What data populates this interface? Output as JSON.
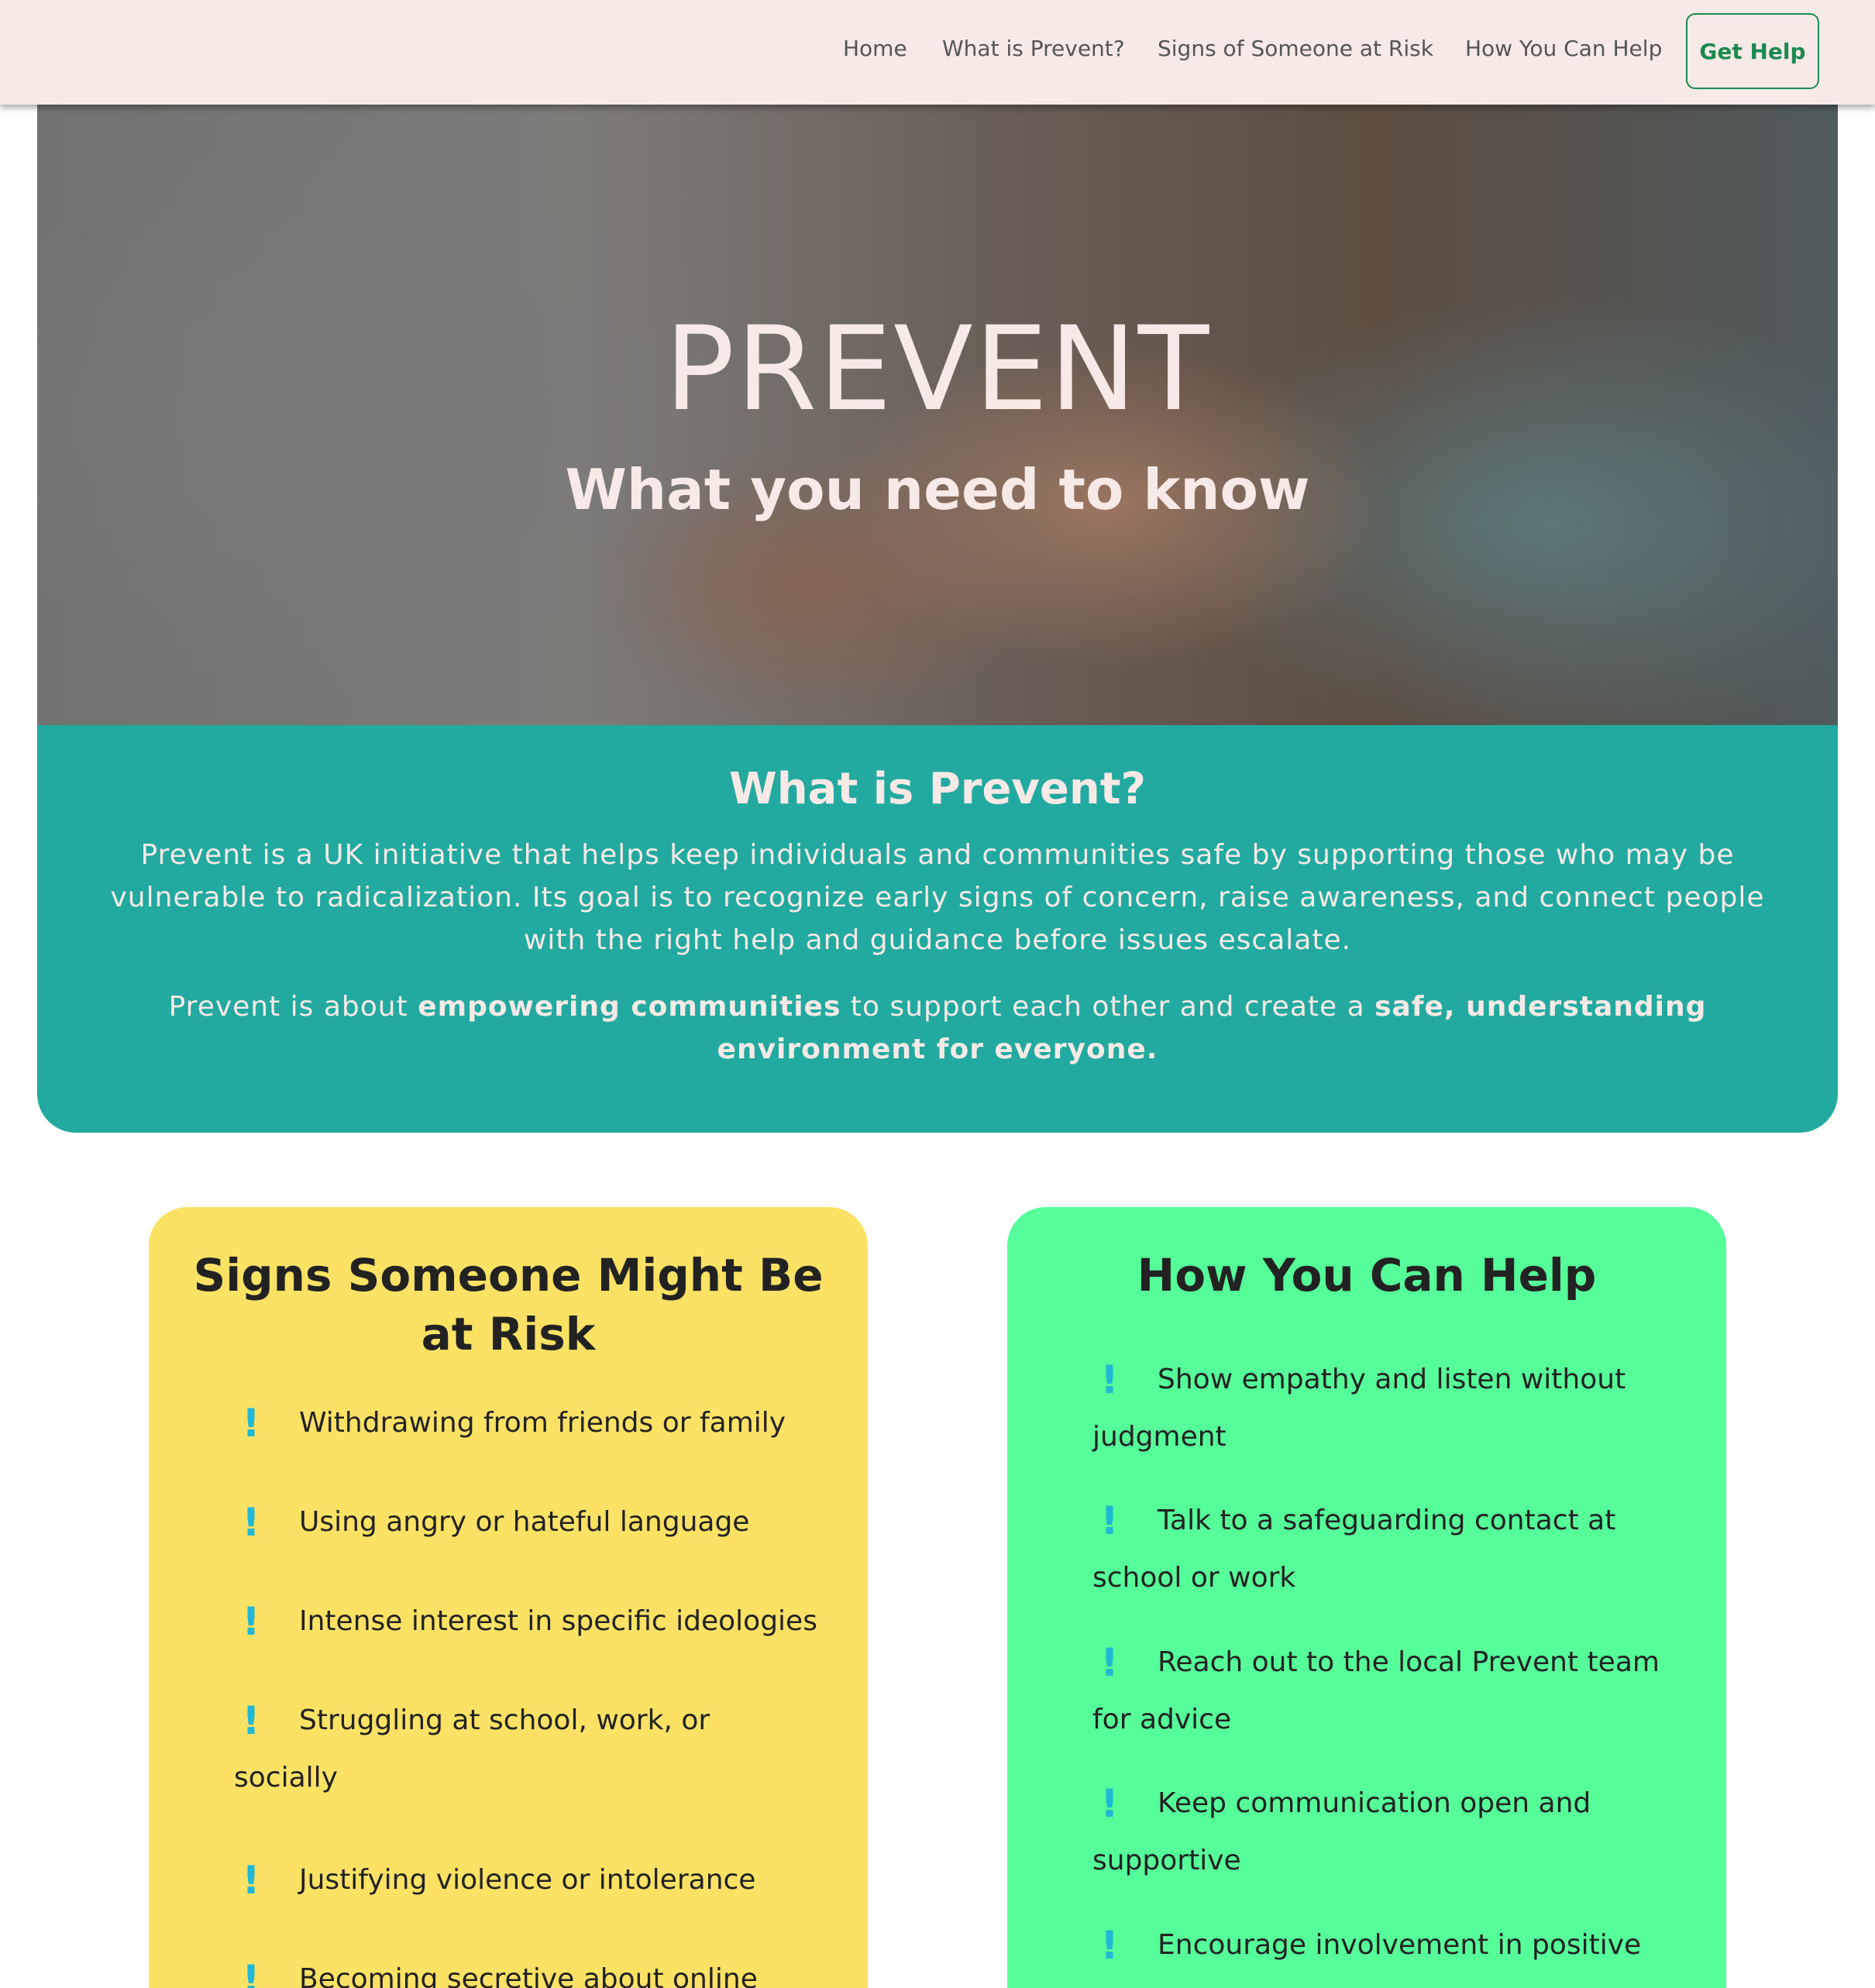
{
  "nav": {
    "links": [
      "Home",
      "What is Prevent?",
      "Signs of Someone at Risk",
      "How You Can Help"
    ],
    "cta": "Get Help"
  },
  "hero": {
    "title": "PREVENT",
    "subtitle": "What you need to know"
  },
  "about": {
    "title": "What is Prevent?",
    "p1": "Prevent is a UK initiative that helps keep individuals and communities safe by supporting those who may be vulnerable to radicalization. Its goal is to recognize early signs of concern, raise awareness, and connect people with the right help and guidance before issues escalate.",
    "p2_a": "Prevent is about ",
    "p2_b": "empowering communities",
    "p2_c": " to support each other and create a ",
    "p2_d": "safe, understanding environment for everyone."
  },
  "signs": {
    "title": "Signs Someone Might Be at Risk",
    "icon": "exclamation-icon",
    "items": [
      "Withdrawing from friends or family",
      "Using angry or hateful language",
      "Intense interest in specific ideologies",
      "Struggling at school, work, or socially",
      "Justifying violence or intolerance",
      "Becoming secretive about online"
    ]
  },
  "help": {
    "title": "How You Can Help",
    "items": [
      "Show empathy and listen without judgment",
      "Talk to a safeguarding contact at school or work",
      "Reach out to the local Prevent team for advice",
      "Keep communication open and supportive",
      "Encourage involvement in positive"
    ]
  },
  "colors": {
    "nav_bg": "#f7e9e6",
    "accent_green": "#1c8a4f",
    "teal": "#22aaa0",
    "yellow": "#fce264",
    "mint": "#55fe99",
    "icon_blue": "#1fb8d6"
  }
}
